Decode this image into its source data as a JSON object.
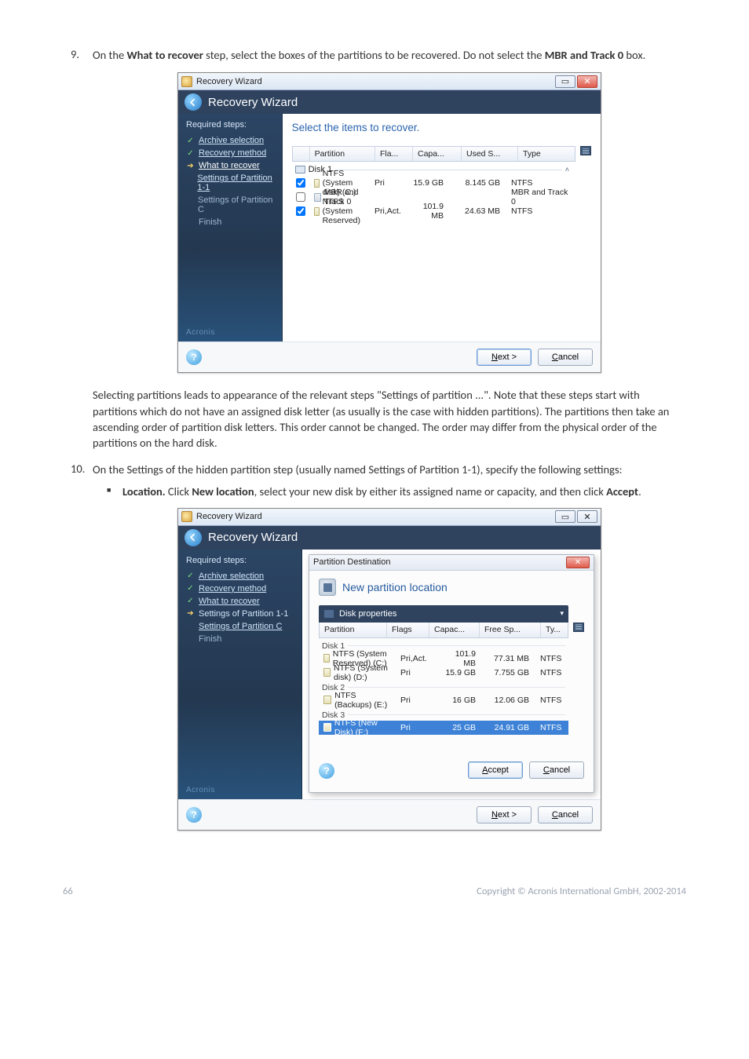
{
  "doc": {
    "item9_num": "9.",
    "item9_p1_a": "On the ",
    "item9_p1_b": "What to recover",
    "item9_p1_c": " step, select the boxes of the partitions to be recovered. Do not select the ",
    "item9_p1_d": "MBR and Track 0",
    "item9_p1_e": " box.",
    "item9_p2": "Selecting partitions leads to appearance of the relevant steps \"Settings of partition ...\". Note that these steps start with partitions which do not have an assigned disk letter (as usually is the case with hidden partitions). The partitions then take an ascending order of partition disk letters. This order cannot be changed. The order may differ from the physical order of the partitions on the hard disk.",
    "item10_num": "10.",
    "item10_p1": "On the Settings of the hidden partition step (usually named Settings of Partition 1-1), specify the following settings:",
    "item10_loc_a": "Location.",
    "item10_loc_b": " Click ",
    "item10_loc_c": "New location",
    "item10_loc_d": ", select your new disk by either its assigned name or capacity, and then click ",
    "item10_loc_e": "Accept",
    "item10_loc_f": "."
  },
  "wiz1": {
    "window_title": "Recovery Wizard",
    "header_title": "Recovery Wizard",
    "steps_hdr": "Required steps:",
    "steps": {
      "archive": "Archive selection",
      "method": "Recovery method",
      "what": "What to recover",
      "p11": "Settings of Partition 1-1",
      "pc": "Settings of Partition C",
      "finish": "Finish"
    },
    "main_title": "Select the items to recover.",
    "columns": {
      "partition": "Partition",
      "fla": "Fla...",
      "capa": "Capa...",
      "used": "Used S...",
      "type": "Type"
    },
    "group": "Disk 1",
    "rows": [
      {
        "name": "NTFS (System disk) (C:)",
        "fla": "Pri",
        "capa": "15.9 GB",
        "used": "8.145 GB",
        "type": "NTFS"
      },
      {
        "name": "MBR and Track 0",
        "fla": "",
        "capa": "",
        "used": "",
        "type": "MBR and Track 0"
      },
      {
        "name": "NTFS (System Reserved)",
        "fla": "Pri,Act.",
        "capa": "101.9 MB",
        "used": "24.63 MB",
        "type": "NTFS"
      }
    ],
    "footer": {
      "help": "?",
      "next": "ext >",
      "next_u": "N",
      "cancel": "ancel",
      "cancel_u": "C"
    },
    "winbtns": {
      "minmax": "▭",
      "close": "✕"
    }
  },
  "wiz2": {
    "window_title": "Recovery Wizard",
    "header_title": "Recovery Wizard",
    "steps_hdr": "Required steps:",
    "steps": {
      "archive": "Archive selection",
      "method": "Recovery method",
      "what": "What to recover",
      "p11": "Settings of Partition 1-1",
      "pc": "Settings of Partition C",
      "finish": "Finish"
    },
    "dialog": {
      "title": "Partition Destination",
      "newloc": "New partition location",
      "props": "Disk properties",
      "columns": {
        "partition": "Partition",
        "flags": "Flags",
        "capac": "Capac...",
        "free": "Free Sp...",
        "ty": "Ty..."
      },
      "groups": {
        "d1": "Disk 1",
        "d2": "Disk 2",
        "d3": "Disk 3"
      },
      "rows_d1_0": {
        "part": "NTFS (System Reserved) (C:)",
        "fl": "Pri,Act.",
        "cap": "101.9 MB",
        "free": "77.31 MB",
        "ty": "NTFS"
      },
      "rows_d1_1": {
        "part": "NTFS (System disk) (D:)",
        "fl": "Pri",
        "cap": "15.9 GB",
        "free": "7.755 GB",
        "ty": "NTFS"
      },
      "rows_d2_0": {
        "part": "NTFS (Backups) (E:)",
        "fl": "Pri",
        "cap": "16 GB",
        "free": "12.06 GB",
        "ty": "NTFS"
      },
      "rows_d3_0": {
        "part": "NTFS (New Disk) (F:)",
        "fl": "Pri",
        "cap": "25 GB",
        "free": "24.91 GB",
        "ty": "NTFS"
      },
      "accept": "ccept",
      "accept_u": "A",
      "cancel": "ancel",
      "cancel_u": "C"
    },
    "footer": {
      "help": "?",
      "next": "ext >",
      "next_u": "N",
      "cancel": "ancel",
      "cancel_u": "C"
    },
    "winbtns": {
      "minmax": "▭",
      "close": "✕"
    }
  },
  "footer": {
    "page": "66",
    "copyright": "Copyright © Acronis International GmbH, 2002-2014"
  }
}
